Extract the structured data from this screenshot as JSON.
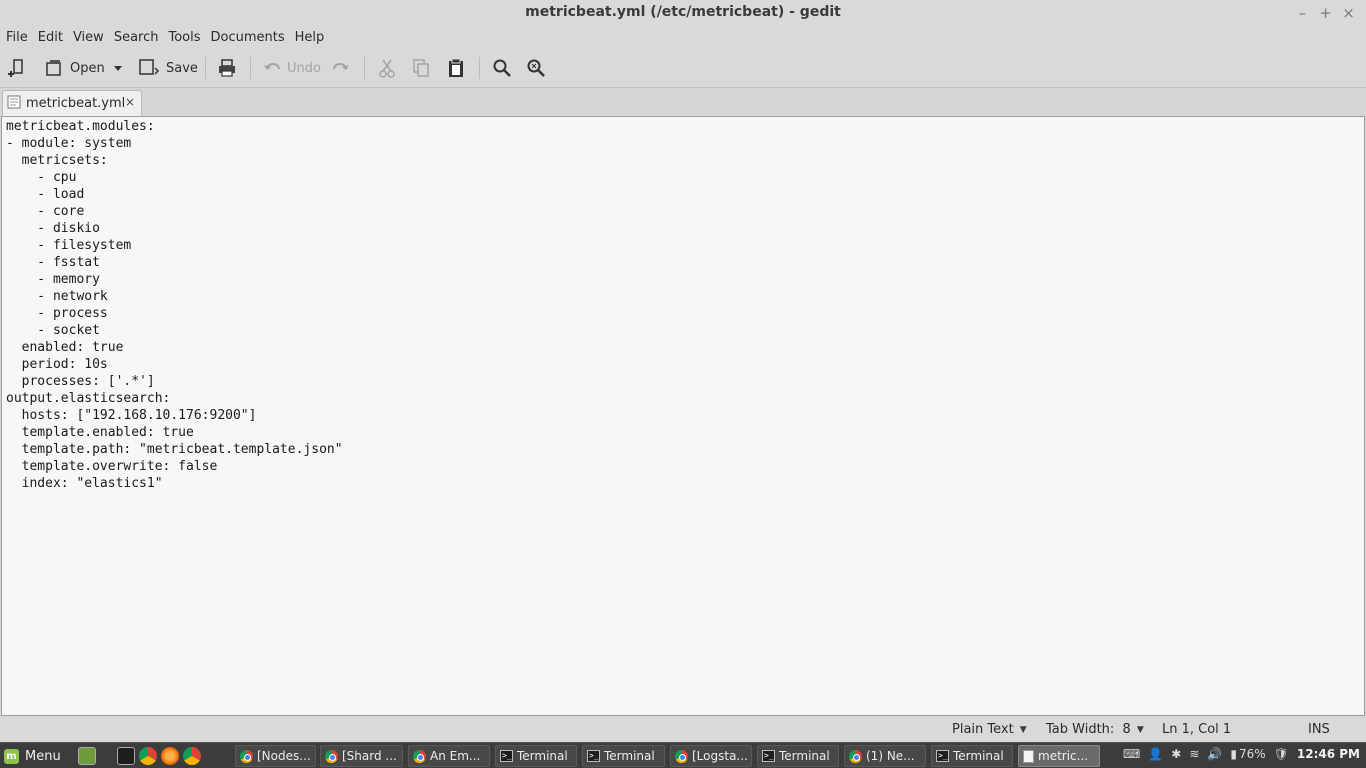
{
  "window": {
    "title": "metricbeat.yml (/etc/metricbeat) - gedit",
    "controls": [
      "–",
      "+",
      "×"
    ]
  },
  "menubar": [
    "File",
    "Edit",
    "View",
    "Search",
    "Tools",
    "Documents",
    "Help"
  ],
  "toolbar": {
    "open_label": "Open",
    "save_label": "Save",
    "undo_label": "Undo"
  },
  "tab": {
    "label": "metricbeat.yml",
    "close": "×"
  },
  "editor": {
    "content": "metricbeat.modules:\n- module: system\n  metricsets:\n    - cpu\n    - load\n    - core\n    - diskio\n    - filesystem\n    - fsstat\n    - memory\n    - network\n    - process\n    - socket\n  enabled: true\n  period: 10s\n  processes: ['.*']\noutput.elasticsearch:\n  hosts: [\"192.168.10.176:9200\"]\n  template.enabled: true\n  template.path: \"metricbeat.template.json\"\n  template.overwrite: false\n  index: \"elastics1\""
  },
  "statusbar": {
    "language": "Plain Text",
    "tab_width": "Tab Width:  8",
    "position": "Ln 1, Col 1",
    "mode": "INS"
  },
  "taskbar": {
    "menu_label": "Menu",
    "tasks": [
      {
        "label": "[Nodes...",
        "icon": "chrome"
      },
      {
        "label": "[Shard ...",
        "icon": "chrome"
      },
      {
        "label": "An Em...",
        "icon": "chrome"
      },
      {
        "label": "Terminal",
        "icon": "terminal"
      },
      {
        "label": "Terminal",
        "icon": "terminal"
      },
      {
        "label": "[Logsta...",
        "icon": "chrome"
      },
      {
        "label": "Terminal",
        "icon": "terminal"
      },
      {
        "label": "(1) Ne...",
        "icon": "chrome"
      },
      {
        "label": "Terminal",
        "icon": "terminal"
      },
      {
        "label": "metric...",
        "icon": "document"
      }
    ],
    "battery": "76%",
    "clock": "12:46 PM"
  },
  "colors": {
    "chrome_bg": "#d9d9d9",
    "editor_bg": "#f7f7f7",
    "taskbar_bg": "#3c3c3c",
    "mint_green": "#8fc44a"
  }
}
